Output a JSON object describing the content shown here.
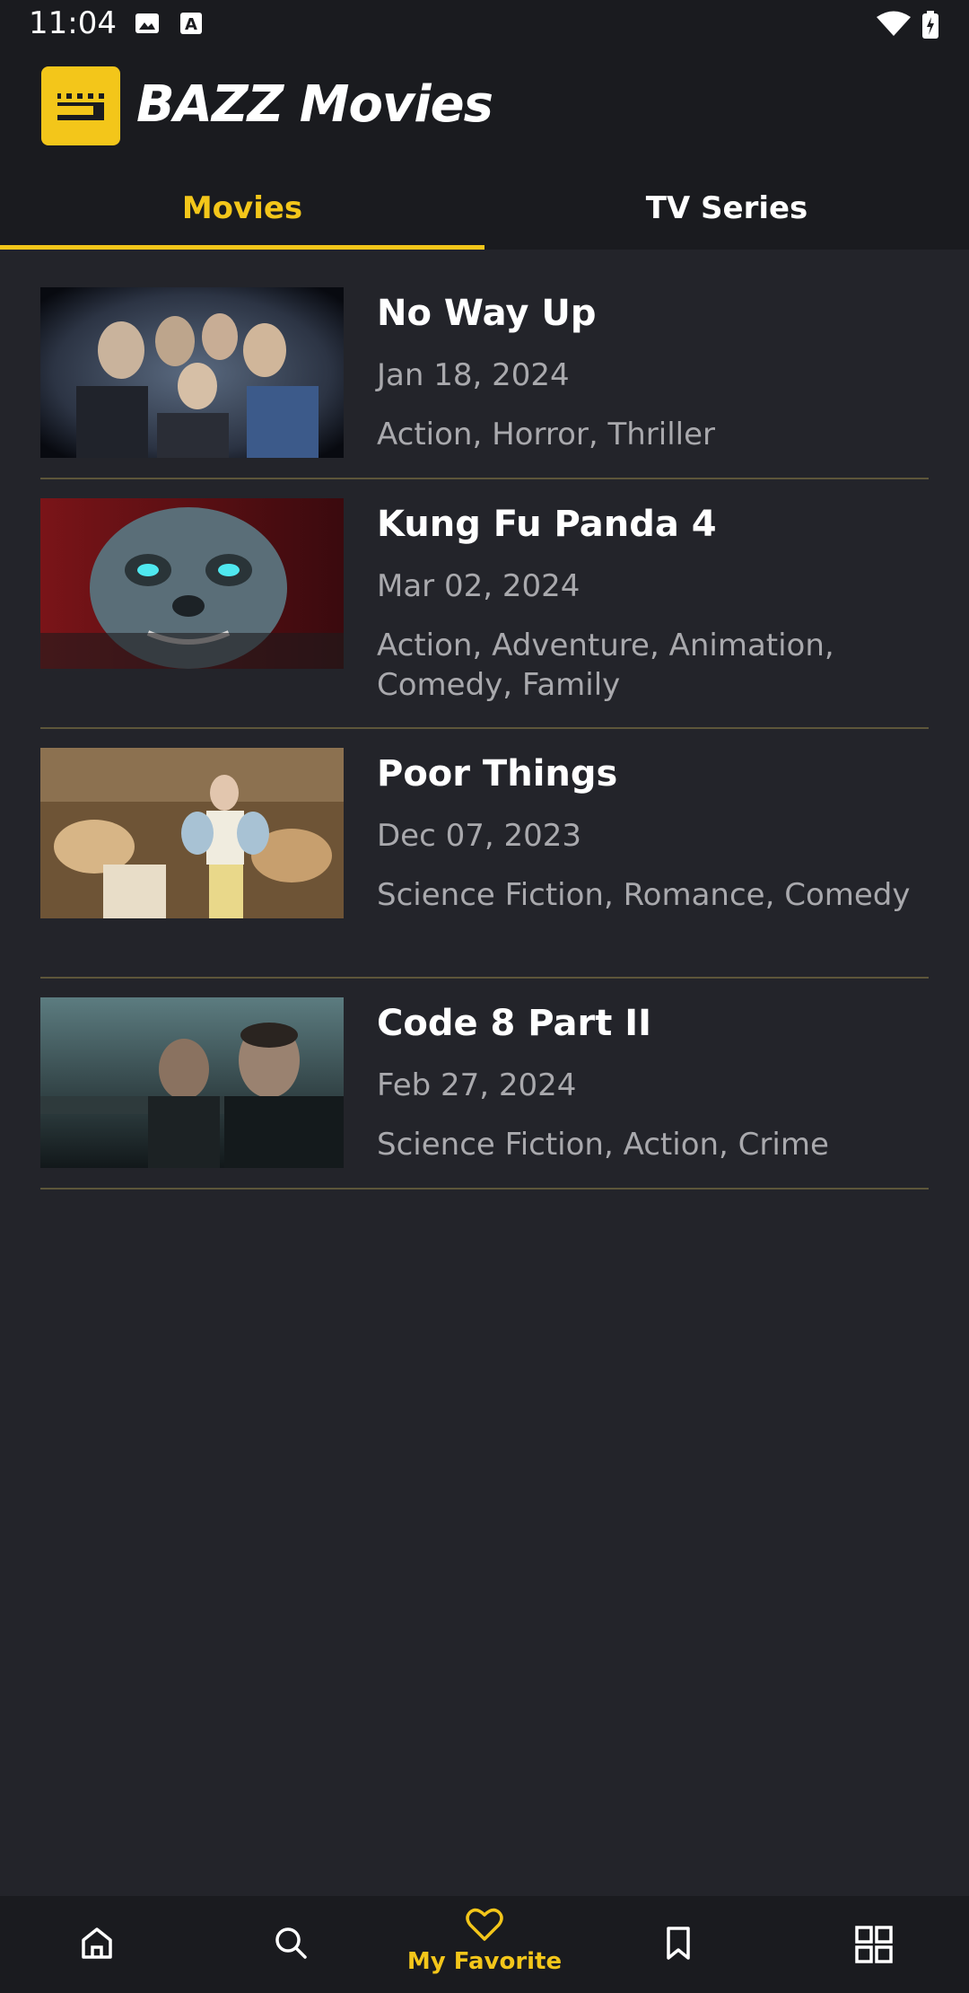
{
  "status_bar": {
    "time": "11:04",
    "icons": [
      "image-icon",
      "font-icon",
      "wifi-icon",
      "battery-icon"
    ]
  },
  "header": {
    "app_title": "BAZZ Movies",
    "logo_icon": "clapperboard-icon"
  },
  "tabs": [
    {
      "label": "Movies",
      "active": true
    },
    {
      "label": "TV Series",
      "active": false
    }
  ],
  "movies": [
    {
      "title": "No Way Up",
      "date": "Jan 18, 2024",
      "genres": "Action, Horror, Thriller"
    },
    {
      "title": "Kung Fu Panda 4",
      "date": "Mar 02, 2024",
      "genres": "Action, Adventure, Animation, Comedy, Family"
    },
    {
      "title": "Poor Things",
      "date": "Dec 07, 2023",
      "genres": "Science Fiction, Romance, Comedy"
    },
    {
      "title": "Code 8 Part II",
      "date": "Feb 27, 2024",
      "genres": "Science Fiction, Action, Crime"
    }
  ],
  "bottom_nav": {
    "items": [
      {
        "icon": "home-icon"
      },
      {
        "icon": "search-icon"
      },
      {
        "icon": "heart-icon",
        "label": "My Favorite",
        "active": true
      },
      {
        "icon": "bookmark-icon"
      },
      {
        "icon": "grid-icon"
      }
    ]
  },
  "colors": {
    "accent": "#f3c61a",
    "background": "#23242a",
    "bar_background": "#1a1b1f",
    "divider": "#5d563a",
    "secondary_text": "#a9a9ad"
  }
}
